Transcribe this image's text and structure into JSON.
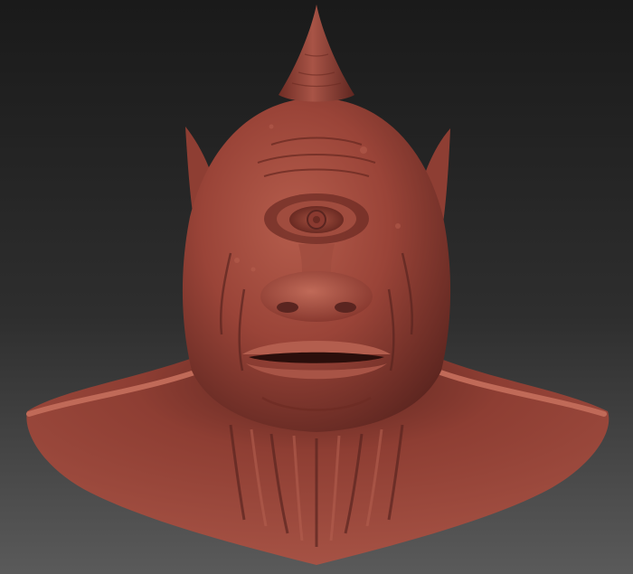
{
  "scene": {
    "subject": "cyclops-bust",
    "colors": {
      "background_top": "#1a1a1a",
      "background_bottom": "#5a5a5a",
      "clay_base": "#9a4438",
      "clay_light": "#b8604f",
      "clay_dark": "#5e2620",
      "clay_shadow": "#3e1712"
    }
  }
}
